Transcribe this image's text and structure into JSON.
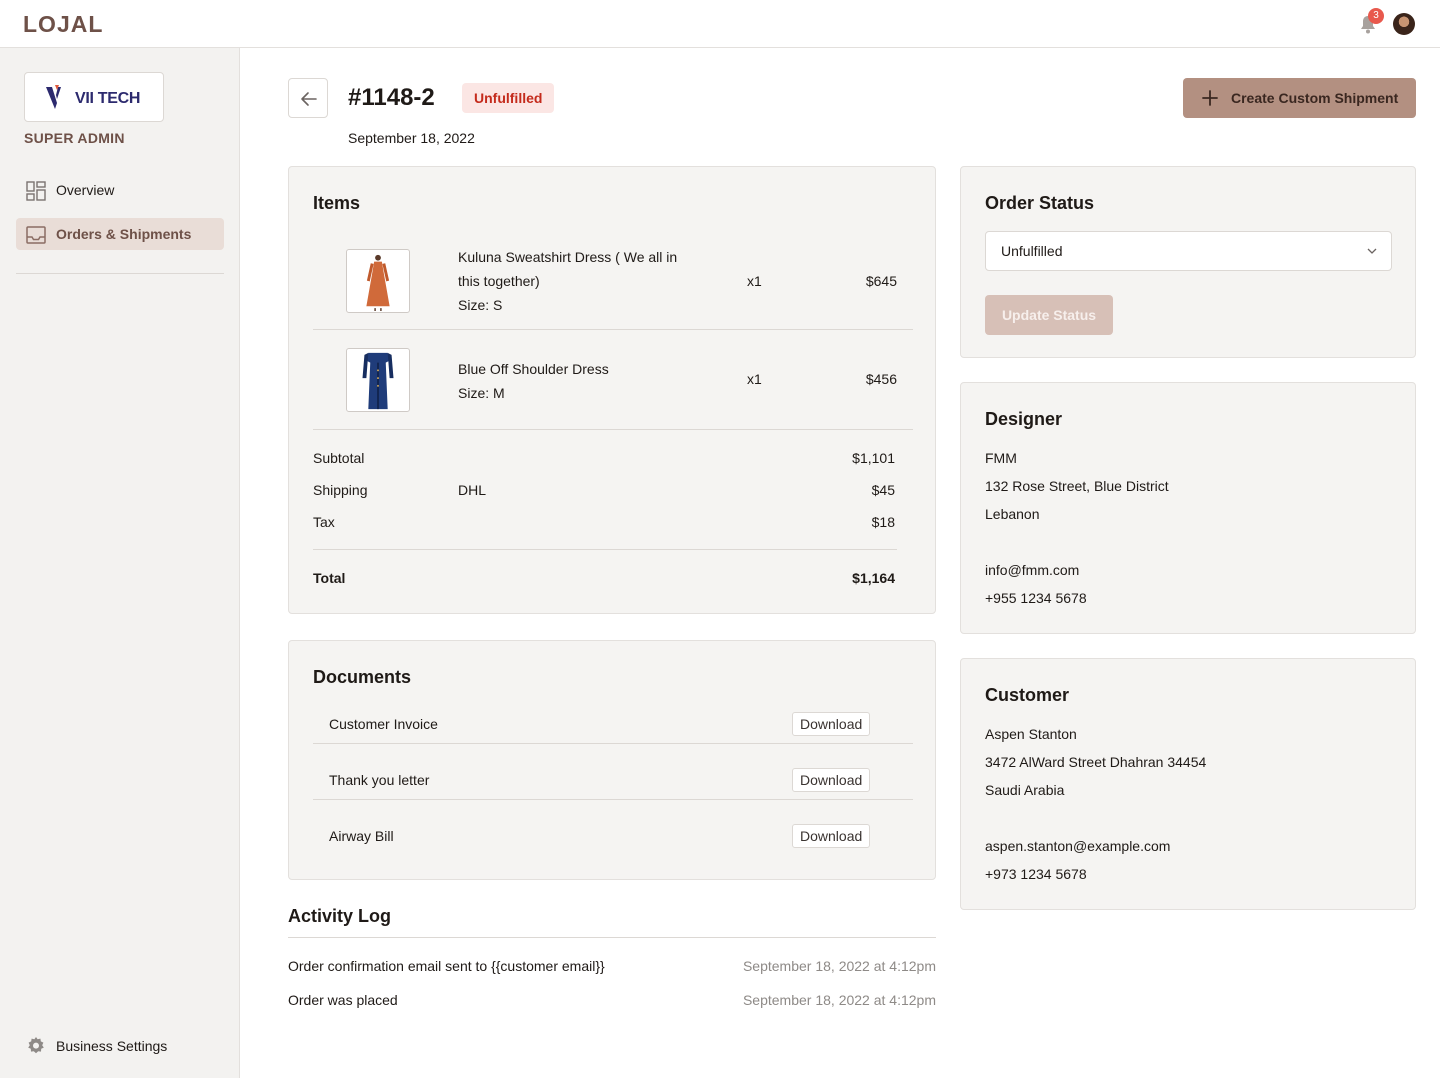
{
  "app": {
    "logo": "LOJAL",
    "notifications_count": "3"
  },
  "sidebar": {
    "brand_name": "VII TECH",
    "role": "SUPER ADMIN",
    "items": [
      {
        "label": "Overview",
        "icon": "grid-icon"
      },
      {
        "label": "Orders & Shipments",
        "icon": "inbox-icon"
      }
    ],
    "settings_label": "Business Settings"
  },
  "header": {
    "order_id": "#1148-2",
    "status": "Unfulfilled",
    "date": "September 18, 2022",
    "create_button": "Create Custom Shipment"
  },
  "items": {
    "title": "Items",
    "rows": [
      {
        "name": "Kuluna Sweatshirt Dress ( We all in this together)",
        "size": "Size: S",
        "qty": "x1",
        "price": "$645"
      },
      {
        "name": "Blue Off Shoulder Dress",
        "size": "Size: M",
        "qty": "x1",
        "price": "$456"
      }
    ],
    "subtotal_label": "Subtotal",
    "subtotal_value": "$1,101",
    "shipping_label": "Shipping",
    "shipping_carrier": "DHL",
    "shipping_value": "$45",
    "tax_label": "Tax",
    "tax_value": "$18",
    "total_label": "Total",
    "total_value": "$1,164"
  },
  "documents": {
    "title": "Documents",
    "download_label": "Download",
    "rows": [
      {
        "name": "Customer Invoice"
      },
      {
        "name": "Thank you letter"
      },
      {
        "name": "Airway Bill"
      }
    ]
  },
  "activity": {
    "title": "Activity Log",
    "rows": [
      {
        "text": "Order confirmation email sent to {{customer email}}",
        "time": "September 18, 2022 at 4:12pm"
      },
      {
        "text": "Order was placed",
        "time": "September 18, 2022 at 4:12pm"
      }
    ]
  },
  "order_status": {
    "title": "Order Status",
    "selected": "Unfulfilled",
    "update_button": "Update Status"
  },
  "designer": {
    "title": "Designer",
    "name": "FMM",
    "address1": "132 Rose Street, Blue District",
    "country": "Lebanon",
    "email": "info@fmm.com",
    "phone": "+955 1234 5678"
  },
  "customer": {
    "title": "Customer",
    "name": "Aspen Stanton",
    "address1": "3472 AlWard Street Dhahran 34454",
    "country": "Saudi Arabia",
    "email": "aspen.stanton@example.com",
    "phone": "+973 1234 5678"
  },
  "colors": {
    "accent": "#b39081",
    "brand": "#6e5148",
    "status_red": "#c42b1c",
    "status_bg": "#fbe6e4"
  }
}
